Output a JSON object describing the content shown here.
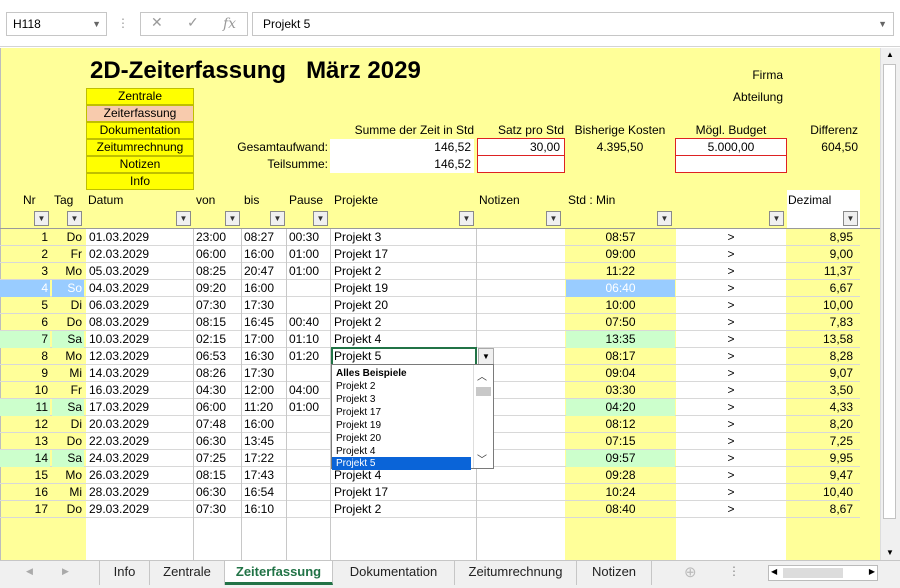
{
  "formula_bar": {
    "cell_ref": "H118",
    "fx": "fx",
    "content": "Projekt 5"
  },
  "header": {
    "title": "2D-Zeiterfassung",
    "month": "März 2029",
    "firma": "Firma",
    "abteilung": "Abteilung",
    "nav": [
      "Zentrale",
      "Zeiterfassung",
      "Dokumentation",
      "Zeitumrechnung",
      "Notizen",
      "Info"
    ],
    "summary_headers": {
      "summe": "Summe der Zeit in Std",
      "satz": "Satz pro Std",
      "kosten": "Bisherige Kosten",
      "budget": "Mögl. Budget",
      "differenz": "Differenz"
    },
    "gesamt_label": "Gesamtaufwand:",
    "teil_label": "Teilsumme:",
    "gesamt_summe": "146,52",
    "satz": "30,00",
    "kosten": "4.395,50",
    "budget": "5.000,00",
    "differenz": "604,50",
    "teil_summe": "146,52"
  },
  "columns": {
    "nr": "Nr",
    "tag": "Tag",
    "datum": "Datum",
    "von": "von",
    "bis": "bis",
    "pause": "Pause",
    "projekte": "Projekte",
    "notizen": "Notizen",
    "stdmin": "Std : Min",
    "dezimal": "Dezimal"
  },
  "rows": [
    {
      "nr": "1",
      "tag": "Do",
      "datum": "01.03.2029",
      "von": "23:00",
      "bis": "08:27",
      "pause": "00:30",
      "projekt": "Projekt 3",
      "stdmin": "08:57",
      "arrow": ">",
      "dez": "8,95",
      "hl": ""
    },
    {
      "nr": "2",
      "tag": "Fr",
      "datum": "02.03.2029",
      "von": "06:00",
      "bis": "16:00",
      "pause": "01:00",
      "projekt": "Projekt 17",
      "stdmin": "09:00",
      "arrow": ">",
      "dez": "9,00",
      "hl": ""
    },
    {
      "nr": "3",
      "tag": "Mo",
      "datum": "05.03.2029",
      "von": "08:25",
      "bis": "20:47",
      "pause": "01:00",
      "projekt": "Projekt 2",
      "stdmin": "11:22",
      "arrow": ">",
      "dez": "11,37",
      "hl": ""
    },
    {
      "nr": "4",
      "tag": "So",
      "datum": "04.03.2029",
      "von": "09:20",
      "bis": "16:00",
      "pause": "",
      "projekt": "Projekt 19",
      "stdmin": "06:40",
      "arrow": ">",
      "dez": "6,67",
      "hl": "blue"
    },
    {
      "nr": "5",
      "tag": "Di",
      "datum": "06.03.2029",
      "von": "07:30",
      "bis": "17:30",
      "pause": "",
      "projekt": "Projekt 20",
      "stdmin": "10:00",
      "arrow": ">",
      "dez": "10,00",
      "hl": ""
    },
    {
      "nr": "6",
      "tag": "Do",
      "datum": "08.03.2029",
      "von": "08:15",
      "bis": "16:45",
      "pause": "00:40",
      "projekt": "Projekt 2",
      "stdmin": "07:50",
      "arrow": ">",
      "dez": "7,83",
      "hl": ""
    },
    {
      "nr": "7",
      "tag": "Sa",
      "datum": "10.03.2029",
      "von": "02:15",
      "bis": "17:00",
      "pause": "01:10",
      "projekt": "Projekt 4",
      "stdmin": "13:35",
      "arrow": ">",
      "dez": "13,58",
      "hl": "green"
    },
    {
      "nr": "8",
      "tag": "Mo",
      "datum": "12.03.2029",
      "von": "06:53",
      "bis": "16:30",
      "pause": "01:20",
      "projekt": "Projekt 5",
      "stdmin": "08:17",
      "arrow": ">",
      "dez": "8,28",
      "hl": ""
    },
    {
      "nr": "9",
      "tag": "Mi",
      "datum": "14.03.2029",
      "von": "08:26",
      "bis": "17:30",
      "pause": "",
      "projekt": "",
      "stdmin": "09:04",
      "arrow": ">",
      "dez": "9,07",
      "hl": ""
    },
    {
      "nr": "10",
      "tag": "Fr",
      "datum": "16.03.2029",
      "von": "04:30",
      "bis": "12:00",
      "pause": "04:00",
      "projekt": "",
      "stdmin": "03:30",
      "arrow": ">",
      "dez": "3,50",
      "hl": ""
    },
    {
      "nr": "11",
      "tag": "Sa",
      "datum": "17.03.2029",
      "von": "06:00",
      "bis": "11:20",
      "pause": "01:00",
      "projekt": "",
      "stdmin": "04:20",
      "arrow": ">",
      "dez": "4,33",
      "hl": "green"
    },
    {
      "nr": "12",
      "tag": "Di",
      "datum": "20.03.2029",
      "von": "07:48",
      "bis": "16:00",
      "pause": "",
      "projekt": "",
      "stdmin": "08:12",
      "arrow": ">",
      "dez": "8,20",
      "hl": ""
    },
    {
      "nr": "13",
      "tag": "Do",
      "datum": "22.03.2029",
      "von": "06:30",
      "bis": "13:45",
      "pause": "",
      "projekt": "",
      "stdmin": "07:15",
      "arrow": ">",
      "dez": "7,25",
      "hl": ""
    },
    {
      "nr": "14",
      "tag": "Sa",
      "datum": "24.03.2029",
      "von": "07:25",
      "bis": "17:22",
      "pause": "",
      "projekt": "",
      "stdmin": "09:57",
      "arrow": ">",
      "dez": "9,95",
      "hl": "green"
    },
    {
      "nr": "15",
      "tag": "Mo",
      "datum": "26.03.2029",
      "von": "08:15",
      "bis": "17:43",
      "pause": "",
      "projekt": "Projekt 4",
      "stdmin": "09:28",
      "arrow": ">",
      "dez": "9,47",
      "hl": ""
    },
    {
      "nr": "16",
      "tag": "Mi",
      "datum": "28.03.2029",
      "von": "06:30",
      "bis": "16:54",
      "pause": "",
      "projekt": "Projekt 17",
      "stdmin": "10:24",
      "arrow": ">",
      "dez": "10,40",
      "hl": ""
    },
    {
      "nr": "17",
      "tag": "Do",
      "datum": "29.03.2029",
      "von": "07:30",
      "bis": "16:10",
      "pause": "",
      "projekt": "Projekt 2",
      "stdmin": "08:40",
      "arrow": ">",
      "dez": "8,67",
      "hl": ""
    }
  ],
  "dropdown": {
    "items": [
      "Alles Beispiele",
      "Projekt 2",
      "Projekt 3",
      "Projekt 17",
      "Projekt 19",
      "Projekt 20",
      "Projekt 4",
      "Projekt 5"
    ],
    "selected": "Projekt 5"
  },
  "tabs": [
    "Info",
    "Zentrale",
    "Zeiterfassung",
    "Dokumentation",
    "Zeitumrechnung",
    "Notizen"
  ],
  "active_tab": "Zeiterfassung",
  "colors": {
    "accent": "#217346",
    "sheet_bg": "#ffff99",
    "highlight_green": "#ccffcc",
    "highlight_blue": "#99ccff",
    "nav_btn": "#ffff00",
    "nav_selected": "#f8cbad"
  }
}
